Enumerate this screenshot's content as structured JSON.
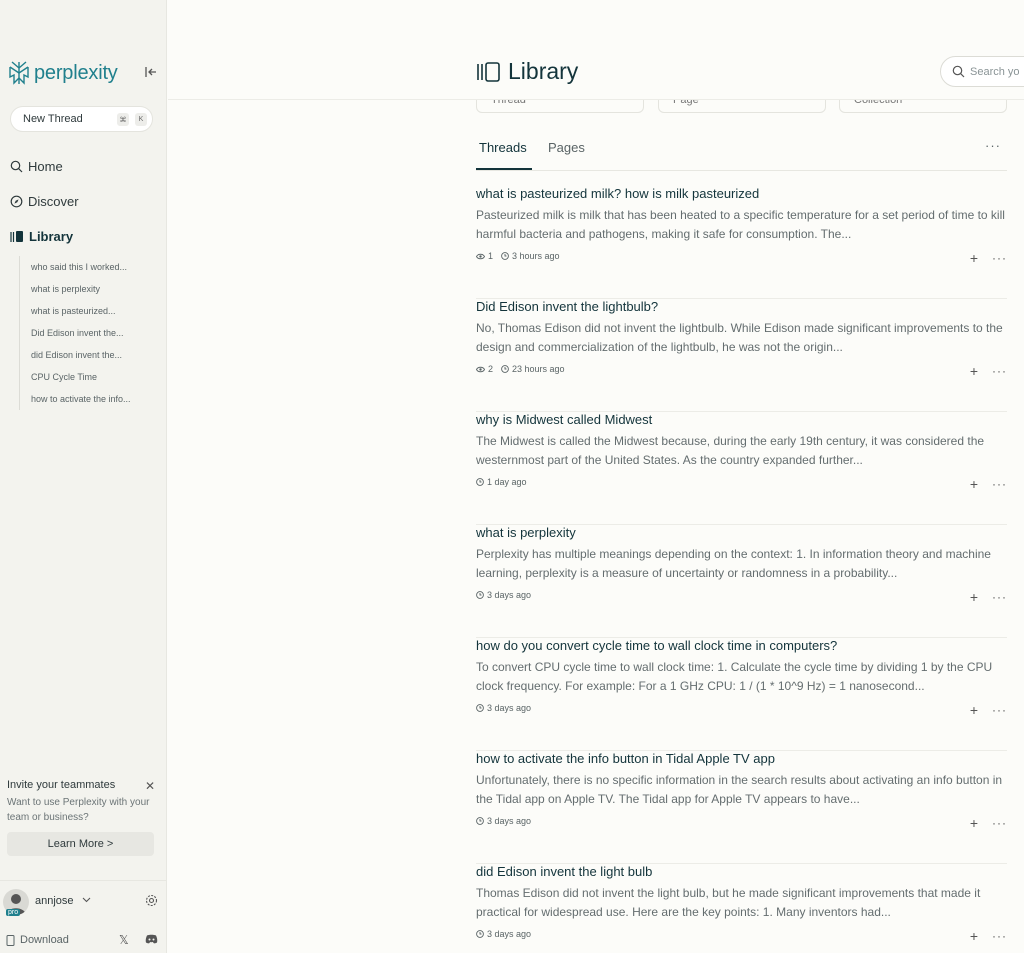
{
  "sidebar": {
    "brand": "perplexity",
    "new_thread": {
      "label": "New Thread",
      "kbd1": "⌘",
      "kbd2": "K"
    },
    "nav": [
      {
        "label": "Home"
      },
      {
        "label": "Discover"
      },
      {
        "label": "Library"
      }
    ],
    "history": [
      "who said this I worked...",
      "what is perplexity",
      "what is pasteurized...",
      "Did Edison invent the...",
      "did Edison invent the...",
      "CPU Cycle Time",
      "how to activate the info..."
    ],
    "invite": {
      "title": "Invite your teammates",
      "desc": "Want to use Perplexity with your team or business?",
      "button": "Learn More >"
    },
    "user": {
      "name": "annjose",
      "badge": "pro"
    },
    "download": "Download"
  },
  "header": {
    "title": "Library",
    "search_placeholder": "Search yo"
  },
  "filters": [
    "Thread",
    "Page",
    "Collection"
  ],
  "tabs": [
    "Threads",
    "Pages"
  ],
  "threads": [
    {
      "title": "what is pasteurized milk? how is milk pasteurized",
      "snippet": "Pasteurized milk is milk that has been heated to a specific temperature for a set period of time to kill harmful bacteria and pathogens, making it safe for consumption. The...",
      "views": "1",
      "time": "3 hours ago"
    },
    {
      "title": "Did Edison invent the lightbulb?",
      "snippet": "No, Thomas Edison did not invent the lightbulb. While Edison made significant improvements to the design and commercialization of the lightbulb, he was not the origin...",
      "views": "2",
      "time": "23 hours ago"
    },
    {
      "title": "why is Midwest called Midwest",
      "snippet": "The Midwest is called the Midwest because, during the early 19th century, it was considered the westernmost part of the United States. As the country expanded further...",
      "views": "",
      "time": "1 day ago"
    },
    {
      "title": "what is perplexity",
      "snippet": "Perplexity has multiple meanings depending on the context: 1. In information theory and machine learning, perplexity is a measure of uncertainty or randomness in a probability...",
      "views": "",
      "time": "3 days ago"
    },
    {
      "title": "how do you convert cycle time to wall clock time in computers?",
      "snippet": "To convert CPU cycle time to wall clock time: 1. Calculate the cycle time by dividing 1 by the CPU clock frequency. For example: For a 1 GHz CPU: 1 / (1 * 10^9 Hz) = 1 nanosecond...",
      "views": "",
      "time": "3 days ago"
    },
    {
      "title": "how to activate the info button in Tidal Apple TV app",
      "snippet": "Unfortunately, there is no specific information in the search results about activating an info button in the Tidal app on Apple TV. The Tidal app for Apple TV appears to have...",
      "views": "",
      "time": "3 days ago"
    },
    {
      "title": "did Edison invent the light bulb",
      "snippet": "Thomas Edison did not invent the light bulb, but he made significant improvements that made it practical for widespread use. Here are the key points: 1. Many inventors had...",
      "views": "",
      "time": "3 days ago"
    }
  ],
  "colors": {
    "accent": "#20808d",
    "text": "#13343b",
    "bg": "#fcfcf9",
    "sidebar_bg": "#f3f3ee"
  }
}
